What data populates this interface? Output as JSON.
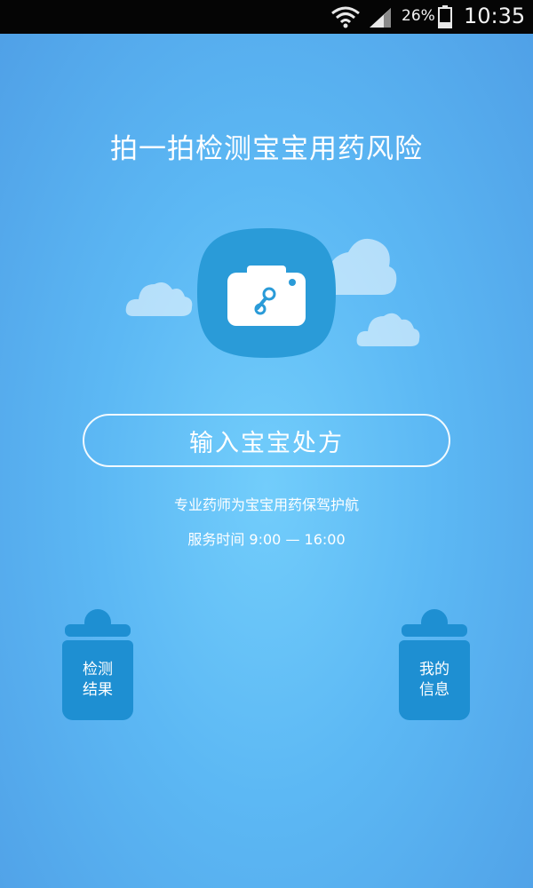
{
  "status_bar": {
    "battery_percent": "26%",
    "time": "10:35",
    "icons": [
      "wifi-icon",
      "cell-signal-icon",
      "battery-icon"
    ]
  },
  "main": {
    "headline": "拍一拍检测宝宝用药风险",
    "camera_icon": "camera-pacifier-icon",
    "prescription_button_label": "输入宝宝处方",
    "tagline": "专业药师为宝宝用药保驾护航",
    "service_hours": "服务时间 9:00 — 16:00"
  },
  "bottom_buttons": {
    "results": {
      "line1": "检测",
      "line2": "结果"
    },
    "my_info": {
      "line1": "我的",
      "line2": "信息"
    }
  },
  "colors": {
    "background_light": "#72cdfb",
    "background_dark": "#4f9fe6",
    "accent_blue": "#1e8fd2",
    "camera_badge": "#2a9bd8",
    "status_bar": "#050505"
  }
}
